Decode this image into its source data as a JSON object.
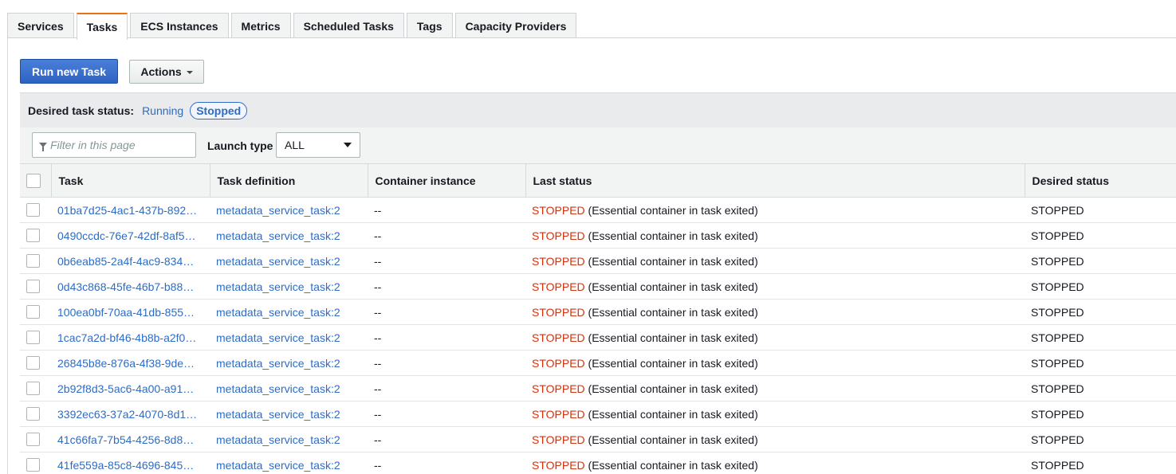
{
  "tabs": [
    {
      "label": "Services",
      "active": false
    },
    {
      "label": "Tasks",
      "active": true
    },
    {
      "label": "ECS Instances",
      "active": false
    },
    {
      "label": "Metrics",
      "active": false
    },
    {
      "label": "Scheduled Tasks",
      "active": false
    },
    {
      "label": "Tags",
      "active": false
    },
    {
      "label": "Capacity Providers",
      "active": false
    }
  ],
  "toolbar": {
    "run_task_label": "Run new Task",
    "actions_label": "Actions"
  },
  "status_filter": {
    "label": "Desired task status:",
    "options": [
      "Running",
      "Stopped"
    ],
    "selected": "Stopped"
  },
  "filter": {
    "placeholder": "Filter in this page",
    "launch_type_label": "Launch type",
    "launch_type_value": "ALL"
  },
  "table": {
    "columns": [
      "Task",
      "Task definition",
      "Container instance",
      "Last status",
      "Desired status"
    ],
    "rows": [
      {
        "task": "01ba7d25-4ac1-437b-892…",
        "definition": "metadata_service_task:2",
        "instance": "--",
        "status": "STOPPED",
        "reason": "(Essential container in task exited)",
        "desired": "STOPPED"
      },
      {
        "task": "0490ccdc-76e7-42df-8af5…",
        "definition": "metadata_service_task:2",
        "instance": "--",
        "status": "STOPPED",
        "reason": "(Essential container in task exited)",
        "desired": "STOPPED"
      },
      {
        "task": "0b6eab85-2a4f-4ac9-834…",
        "definition": "metadata_service_task:2",
        "instance": "--",
        "status": "STOPPED",
        "reason": "(Essential container in task exited)",
        "desired": "STOPPED"
      },
      {
        "task": "0d43c868-45fe-46b7-b88…",
        "definition": "metadata_service_task:2",
        "instance": "--",
        "status": "STOPPED",
        "reason": "(Essential container in task exited)",
        "desired": "STOPPED"
      },
      {
        "task": "100ea0bf-70aa-41db-855…",
        "definition": "metadata_service_task:2",
        "instance": "--",
        "status": "STOPPED",
        "reason": "(Essential container in task exited)",
        "desired": "STOPPED"
      },
      {
        "task": "1cac7a2d-bf46-4b8b-a2f0…",
        "definition": "metadata_service_task:2",
        "instance": "--",
        "status": "STOPPED",
        "reason": "(Essential container in task exited)",
        "desired": "STOPPED"
      },
      {
        "task": "26845b8e-876a-4f38-9de…",
        "definition": "metadata_service_task:2",
        "instance": "--",
        "status": "STOPPED",
        "reason": "(Essential container in task exited)",
        "desired": "STOPPED"
      },
      {
        "task": "2b92f8d3-5ac6-4a00-a91…",
        "definition": "metadata_service_task:2",
        "instance": "--",
        "status": "STOPPED",
        "reason": "(Essential container in task exited)",
        "desired": "STOPPED"
      },
      {
        "task": "3392ec63-37a2-4070-8d1…",
        "definition": "metadata_service_task:2",
        "instance": "--",
        "status": "STOPPED",
        "reason": "(Essential container in task exited)",
        "desired": "STOPPED"
      },
      {
        "task": "41c66fa7-7b54-4256-8d8…",
        "definition": "metadata_service_task:2",
        "instance": "--",
        "status": "STOPPED",
        "reason": "(Essential container in task exited)",
        "desired": "STOPPED"
      },
      {
        "task": "41fe559a-85c8-4696-845…",
        "definition": "metadata_service_task:2",
        "instance": "--",
        "status": "STOPPED",
        "reason": "(Essential container in task exited)",
        "desired": "STOPPED"
      }
    ]
  },
  "colors": {
    "link": "#2e6cc4",
    "stopped": "#d13212",
    "active_tab_accent": "#ec7211",
    "primary_button": "#2e63c6"
  }
}
